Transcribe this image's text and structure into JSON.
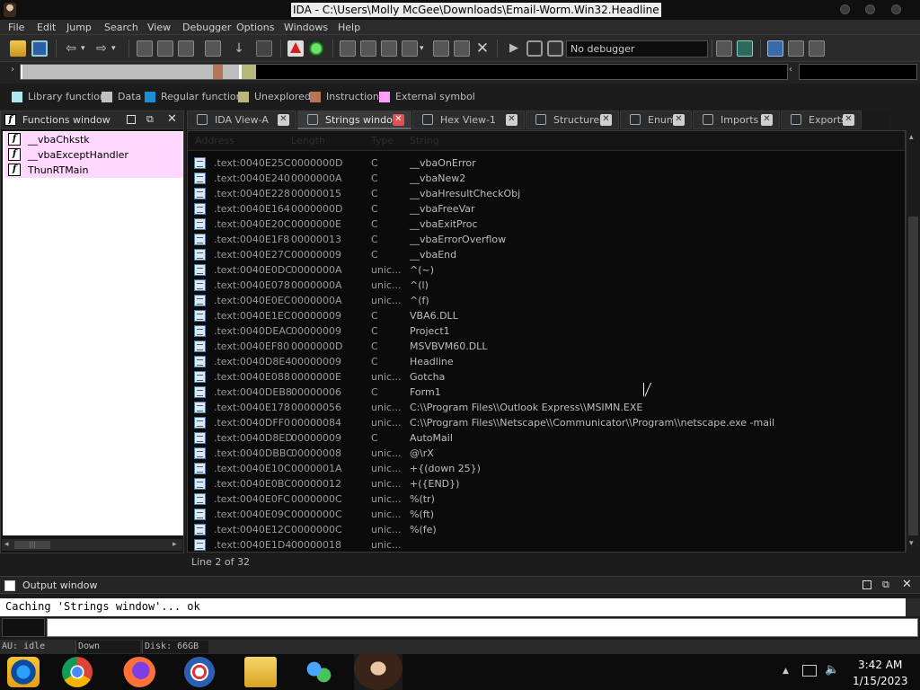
{
  "window": {
    "title": "IDA - C:\\Users\\Molly McGee\\Downloads\\Email-Worm.Win32.Headline"
  },
  "menu": [
    "File",
    "Edit",
    "Jump",
    "Search",
    "View",
    "Debugger",
    "Options",
    "Windows",
    "Help"
  ],
  "toolbar": {
    "debugger_select": "No debugger"
  },
  "legend": [
    {
      "label": "Library function",
      "color": "#aee8f0"
    },
    {
      "label": "Data",
      "color": "#c0c0c0"
    },
    {
      "label": "Regular function",
      "color": "#1a8fd8"
    },
    {
      "label": "Unexplored",
      "color": "#b8b87a"
    },
    {
      "label": "Instruction",
      "color": "#b87555"
    },
    {
      "label": "External symbol",
      "color": "#ff9cff"
    }
  ],
  "functions_window": {
    "title": "Functions window",
    "items": [
      "__vbaChkstk",
      "__vbaExceptHandler",
      "ThunRTMain"
    ]
  },
  "tabs": [
    {
      "label": "IDA View-A",
      "active": false
    },
    {
      "label": "Strings window",
      "active": true
    },
    {
      "label": "Hex View-1",
      "active": false
    },
    {
      "label": "Structures",
      "active": false
    },
    {
      "label": "Enums",
      "active": false
    },
    {
      "label": "Imports",
      "active": false
    },
    {
      "label": "Exports",
      "active": false
    }
  ],
  "strings": {
    "columns": [
      "Address",
      "Length",
      "Type",
      "String"
    ],
    "rows": [
      {
        "addr": ".text:0040E25C",
        "len": "0000000D",
        "type": "C",
        "val": "__vbaOnError"
      },
      {
        "addr": ".text:0040E240",
        "len": "0000000A",
        "type": "C",
        "val": "__vbaNew2"
      },
      {
        "addr": ".text:0040E228",
        "len": "00000015",
        "type": "C",
        "val": "__vbaHresultCheckObj"
      },
      {
        "addr": ".text:0040E164",
        "len": "0000000D",
        "type": "C",
        "val": "__vbaFreeVar"
      },
      {
        "addr": ".text:0040E20C",
        "len": "0000000E",
        "type": "C",
        "val": "__vbaExitProc"
      },
      {
        "addr": ".text:0040E1F8",
        "len": "00000013",
        "type": "C",
        "val": "__vbaErrorOverflow"
      },
      {
        "addr": ".text:0040E27C",
        "len": "00000009",
        "type": "C",
        "val": "__vbaEnd"
      },
      {
        "addr": ".text:0040E0DC",
        "len": "0000000A",
        "type": "unic...",
        "val": "^(~)"
      },
      {
        "addr": ".text:0040E078",
        "len": "0000000A",
        "type": "unic...",
        "val": "^(l)"
      },
      {
        "addr": ".text:0040E0EC",
        "len": "0000000A",
        "type": "unic...",
        "val": "^(f)"
      },
      {
        "addr": ".text:0040E1EC",
        "len": "00000009",
        "type": "C",
        "val": "VBA6.DLL"
      },
      {
        "addr": ".text:0040DEAC",
        "len": "00000009",
        "type": "C",
        "val": "Project1"
      },
      {
        "addr": ".text:0040EF80",
        "len": "0000000D",
        "type": "C",
        "val": "MSVBVM60.DLL"
      },
      {
        "addr": ".text:0040D8E4",
        "len": "00000009",
        "type": "C",
        "val": "Headline"
      },
      {
        "addr": ".text:0040E088",
        "len": "0000000E",
        "type": "unic...",
        "val": "Gotcha"
      },
      {
        "addr": ".text:0040DEB8",
        "len": "00000006",
        "type": "C",
        "val": "Form1"
      },
      {
        "addr": ".text:0040E178",
        "len": "00000056",
        "type": "unic...",
        "val": "C:\\\\Program Files\\\\Outlook Express\\\\MSIMN.EXE"
      },
      {
        "addr": ".text:0040DFF0",
        "len": "00000084",
        "type": "unic...",
        "val": "C:\\\\Program Files\\\\Netscape\\\\Communicator\\\\Program\\\\netscape.exe -mail"
      },
      {
        "addr": ".text:0040D8ED",
        "len": "00000009",
        "type": "C",
        "val": "AutoMail"
      },
      {
        "addr": ".text:0040DBBC",
        "len": "00000008",
        "type": "unic...",
        "val": "@\\rX"
      },
      {
        "addr": ".text:0040E10C",
        "len": "0000001A",
        "type": "unic...",
        "val": "+{(down 25})"
      },
      {
        "addr": ".text:0040E0BC",
        "len": "00000012",
        "type": "unic...",
        "val": "+({END})"
      },
      {
        "addr": ".text:0040E0FC",
        "len": "0000000C",
        "type": "unic...",
        "val": "%(tr)"
      },
      {
        "addr": ".text:0040E09C",
        "len": "0000000C",
        "type": "unic...",
        "val": "%(ft)"
      },
      {
        "addr": ".text:0040E12C",
        "len": "0000000C",
        "type": "unic...",
        "val": "%(fe)"
      },
      {
        "addr": ".text:0040E1D4",
        "len": "00000018",
        "type": "unic...",
        "val": ""
      }
    ]
  },
  "status": {
    "line": "Line 2 of 32"
  },
  "output_window": {
    "title": "Output window",
    "text": "Caching 'Strings window'... ok"
  },
  "ida_status": {
    "au": "AU:  idle",
    "dir": "Down",
    "disk": "Disk: 66GB"
  },
  "taskbar": {
    "time": "3:42 AM",
    "date": "1/15/2023"
  }
}
